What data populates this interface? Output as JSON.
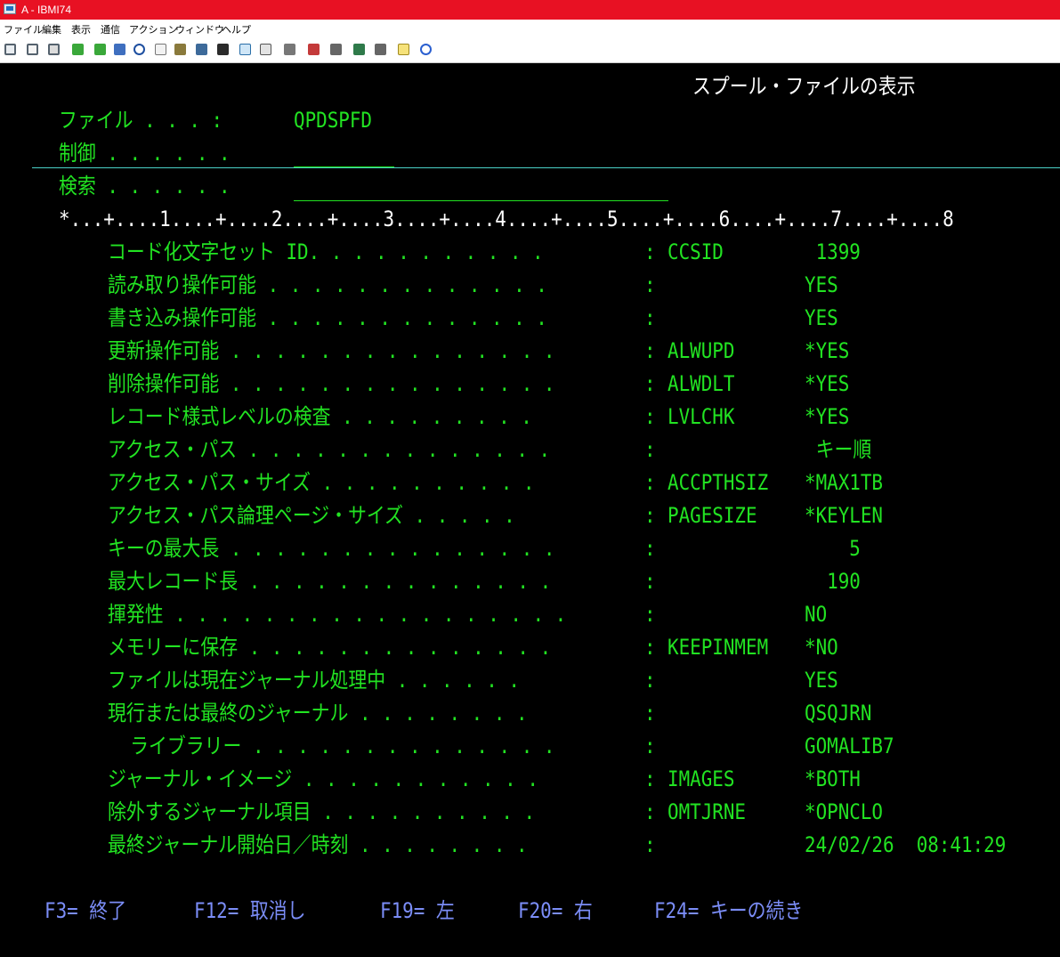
{
  "window": {
    "title": "A - IBMI74"
  },
  "menu": [
    "ファイル",
    "編集",
    "表示",
    "通信",
    "アクション",
    "ウィンドウ",
    "ヘルプ"
  ],
  "toolbar_icons": [
    "copy-icon",
    "paste-icon",
    "print-icon",
    "send-file-icon",
    "receive-file-icon",
    "save-icon",
    "compass-icon",
    "macro-icon",
    "box-icon",
    "palette-icon",
    "display-icon",
    "mail-icon",
    "keypad-icon",
    "hotspot-icon",
    "record-icon",
    "stop-icon",
    "play-icon",
    "pause-icon",
    "notes-icon",
    "help-icon"
  ],
  "screen": {
    "title": "スプール・ファイルの表示",
    "file_label": "ファイル . . . :",
    "file_value": "QPDSPFD",
    "control_label": "制御 . . . . . .",
    "search_label": "検索 . . . . . .",
    "ruler": "*...+....1....+....2....+....3....+....4....+....5....+....6....+....7....+....8",
    "rows": [
      {
        "label": "コード化文字セット ID. . . . . . . . . . .",
        "sep": ":",
        "keyword": "CCSID",
        "value": " 1399"
      },
      {
        "label": "読み取り操作可能 . . . . . . . . . . . . .",
        "sep": ":",
        "keyword": "",
        "value": "YES"
      },
      {
        "label": "書き込み操作可能 . . . . . . . . . . . . .",
        "sep": ":",
        "keyword": "",
        "value": "YES"
      },
      {
        "label": "更新操作可能 . . . . . . . . . . . . . . .",
        "sep": ":",
        "keyword": "ALWUPD",
        "value": "*YES"
      },
      {
        "label": "削除操作可能 . . . . . . . . . . . . . . .",
        "sep": ":",
        "keyword": "ALWDLT",
        "value": "*YES"
      },
      {
        "label": "レコード様式レベルの検査 . . . . . . . . .",
        "sep": ":",
        "keyword": "LVLCHK",
        "value": "*YES"
      },
      {
        "label": "アクセス・パス . . . . . . . . . . . . . .",
        "sep": ":",
        "keyword": "",
        "value": " キー順"
      },
      {
        "label": "アクセス・パス・サイズ . . . . . . . . . .",
        "sep": ":",
        "keyword": "ACCPTHSIZ",
        "value": "*MAX1TB"
      },
      {
        "label": "アクセス・パス論理ページ・サイズ . . . . .",
        "sep": ":",
        "keyword": "PAGESIZE",
        "value": "*KEYLEN"
      },
      {
        "label": "キーの最大長 . . . . . . . . . . . . . . .",
        "sep": ":",
        "keyword": "",
        "value": "    5"
      },
      {
        "label": "最大レコード長 . . . . . . . . . . . . . .",
        "sep": ":",
        "keyword": "",
        "value": "  190"
      },
      {
        "label": "揮発性 . . . . . . . . . . . . . . . . . .",
        "sep": ":",
        "keyword": "",
        "value": "NO"
      },
      {
        "label": "メモリーに保存 . . . . . . . . . . . . . .",
        "sep": ":",
        "keyword": "KEEPINMEM",
        "value": "*NO"
      },
      {
        "label": "ファイルは現在ジャーナル処理中 . . . . . .",
        "sep": ":",
        "keyword": "",
        "value": "YES"
      },
      {
        "label": "現行または最終のジャーナル . . . . . . . .",
        "sep": ":",
        "keyword": "",
        "value": "QSQJRN"
      },
      {
        "label": "  ライブラリー . . . . . . . . . . . . . .",
        "sep": ":",
        "keyword": "",
        "value": "GOMALIB7"
      },
      {
        "label": "ジャーナル・イメージ . . . . . . . . . . .",
        "sep": ":",
        "keyword": "IMAGES",
        "value": "*BOTH"
      },
      {
        "label": "除外するジャーナル項目 . . . . . . . . . .",
        "sep": ":",
        "keyword": "OMTJRNE",
        "value": "*OPNCLO"
      },
      {
        "label": "最終ジャーナル開始日／時刻 . . . . . . . .",
        "sep": ":",
        "keyword": "",
        "value": "24/02/26  08:41:29"
      }
    ],
    "fkeys": [
      "F3= 終了",
      "F12= 取消し",
      "F19= 左",
      "F20= 右",
      "F24= キーの続き"
    ]
  }
}
